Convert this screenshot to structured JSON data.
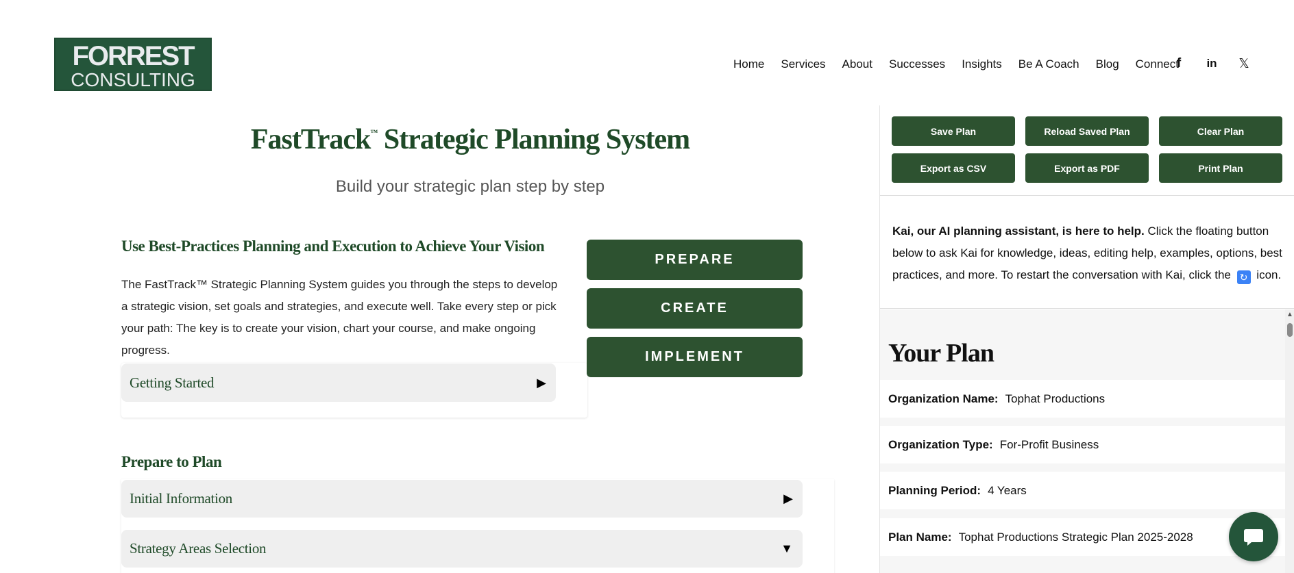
{
  "logo": {
    "line1": "FORREST",
    "line2": "CONSULTING"
  },
  "nav": {
    "items": [
      "Home",
      "Services",
      "About",
      "Successes",
      "Insights",
      "Be A Coach",
      "Blog",
      "Connect"
    ],
    "social": {
      "facebook": "f",
      "linkedin": "in",
      "x": "𝕏"
    }
  },
  "main": {
    "title": "FastTrack",
    "tm": "™",
    "title_rest": " Strategic Planning System",
    "subtitle": "Build your strategic plan step by step",
    "section_heading": "Use Best-Practices Planning and Execution to Achieve Your Vision",
    "intro": "The FastTrack™ Strategic Planning System guides you through the steps to develop a strategic vision, set goals and strategies, and execute well. Take every step or pick your path: The key is to create your vision, chart your course, and make ongoing progress.",
    "getting_started": {
      "label": "Getting Started",
      "arrow": "▶"
    },
    "phase_buttons": [
      "PREPARE",
      "CREATE",
      "IMPLEMENT"
    ],
    "prepare_heading": "Prepare to Plan",
    "accordions": [
      {
        "label": "Initial Information",
        "arrow": "▶"
      },
      {
        "label": "Strategy Areas Selection",
        "arrow": "▼"
      }
    ]
  },
  "panel": {
    "buttons": [
      "Save Plan",
      "Reload Saved Plan",
      "Clear Plan",
      "Export as CSV",
      "Export as PDF",
      "Print Plan"
    ],
    "kai_bold": "Kai, our AI planning assistant, is here to help.",
    "kai_text1": " Click the floating button below to ask Kai for knowledge, ideas, editing help, examples, options, best practices, and more. To restart the conversation with Kai, click the ",
    "kai_icon": "🔄",
    "kai_text2": " icon.",
    "your_plan": "Your Plan",
    "rows": [
      {
        "key": "Organization Name:",
        "value": "Tophat Productions"
      },
      {
        "key": "Organization Type:",
        "value": "For-Profit Business"
      },
      {
        "key": "Planning Period:",
        "value": "4 Years"
      },
      {
        "key": "Plan Name:",
        "value": "Tophat Productions Strategic Plan 2025-2028"
      }
    ]
  },
  "colors": {
    "brand_green": "#2d5230",
    "heading_green": "#1f4a28",
    "logo_green": "#24553a"
  }
}
